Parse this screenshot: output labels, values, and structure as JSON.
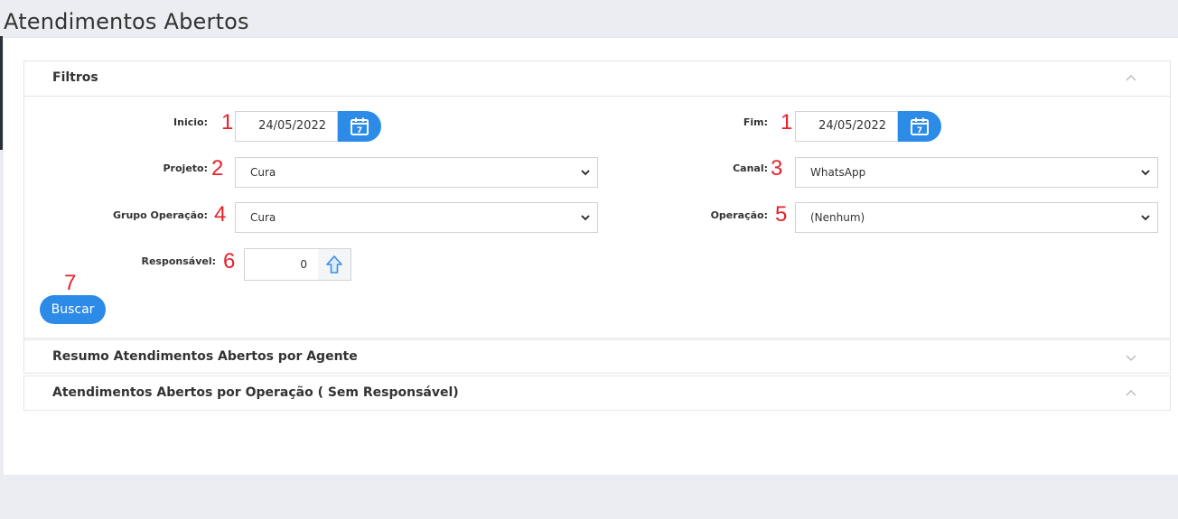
{
  "page": {
    "title": "Atendimentos Abertos"
  },
  "panels": {
    "filtros": {
      "title": "Filtros",
      "fields": {
        "inicio": {
          "label": "Inicio:",
          "marker": "1",
          "value": "24/05/2022"
        },
        "fim": {
          "label": "Fim:",
          "marker": "1",
          "value": "24/05/2022"
        },
        "projeto": {
          "label": "Projeto:",
          "marker": "2",
          "value": "Cura"
        },
        "canal": {
          "label": "Canal:",
          "marker": "3",
          "value": "WhatsApp"
        },
        "grupo_operacao": {
          "label": "Grupo Operação:",
          "marker": "4",
          "value": "Cura"
        },
        "operacao": {
          "label": "Operação:",
          "marker": "5",
          "value": "(Nenhum)"
        },
        "responsavel": {
          "label": "Responsável:",
          "marker": "6",
          "value": "0"
        }
      },
      "buscar": {
        "marker": "7",
        "label": "Buscar"
      }
    },
    "resumo": {
      "title": "Resumo Atendimentos Abertos por Agente"
    },
    "por_operacao": {
      "title": "Atendimentos Abertos por Operação ( Sem Responsável)"
    }
  },
  "icons": {
    "calendar": "calendar-icon",
    "chevron_up": "chevron-up-icon",
    "chevron_down": "chevron-down-icon",
    "select_caret": "caret-down-icon",
    "arrow_up": "arrow-up-icon"
  },
  "colors": {
    "accent": "#2d8be8",
    "marker": "#e8202a",
    "background": "#ebedf2"
  }
}
